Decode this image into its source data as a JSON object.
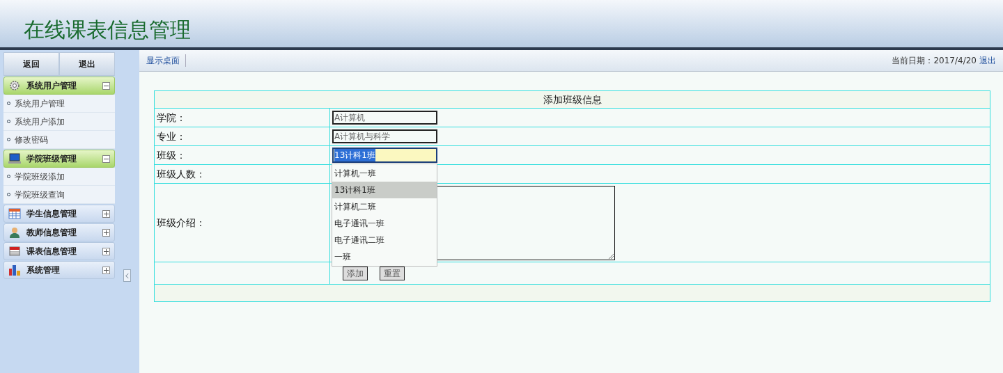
{
  "header": {
    "title": "在线课表信息管理"
  },
  "sidebar": {
    "buttons": [
      "返回",
      "退出"
    ],
    "groups": [
      {
        "label": "系统用户管理",
        "expanded": true,
        "items": [
          "系统用户管理",
          "系统用户添加",
          "修改密码"
        ]
      },
      {
        "label": "学院班级管理",
        "expanded": true,
        "items": [
          "学院班级添加",
          "学院班级查询"
        ]
      },
      {
        "label": "学生信息管理",
        "expanded": false
      },
      {
        "label": "教师信息管理",
        "expanded": false
      },
      {
        "label": "课表信息管理",
        "expanded": false
      },
      {
        "label": "系统管理",
        "expanded": false
      }
    ]
  },
  "toolbar": {
    "link": "显示桌面",
    "date_label": "当前日期：2017/4/20",
    "logout": "退出"
  },
  "form": {
    "title": "添加班级信息",
    "fields": [
      {
        "label": "学院：",
        "kind": "input",
        "value": "A计算机"
      },
      {
        "label": "专业：",
        "kind": "input",
        "value": "A计算机与科学"
      },
      {
        "label": "班级：",
        "kind": "combo",
        "value": "13计科1班",
        "text_selected": true
      },
      {
        "label": "班级人数：",
        "kind": "blank"
      },
      {
        "label": "班级介绍：",
        "kind": "textarea"
      }
    ],
    "suggestions": [
      {
        "label": "计算机一班",
        "selected": false
      },
      {
        "label": "13计科1班",
        "selected": true
      },
      {
        "label": "计算机二班",
        "selected": false
      },
      {
        "label": "电子通讯一班",
        "selected": false
      },
      {
        "label": "电子通讯二班",
        "selected": false
      },
      {
        "label": "一班",
        "selected": false
      }
    ],
    "buttons": [
      "添加",
      "重置"
    ]
  }
}
